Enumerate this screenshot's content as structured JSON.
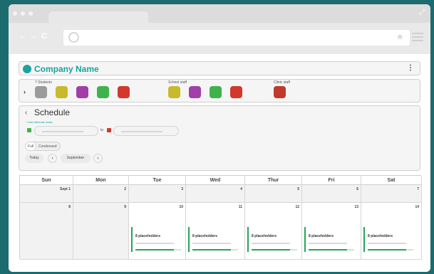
{
  "header": {
    "company_name": "Company Name",
    "menu_glyph": "⋮"
  },
  "staff": {
    "expand_glyph": "›",
    "groups": [
      {
        "label": "7 Students",
        "colors": [
          "#9b9b9b",
          "#c9b92c",
          "#a23ea7",
          "#3fb34b",
          "#d0392b"
        ]
      },
      {
        "label": "School staff",
        "colors": [
          "#c9b92c",
          "#a23ea7",
          "#3fb34b",
          "#d0392b"
        ]
      },
      {
        "label": "Clinic staff",
        "colors": [
          "#c0392b"
        ]
      }
    ]
  },
  "schedule": {
    "title": "Schedule",
    "back_glyph": "‹",
    "add_link": "+ Add alternate dates",
    "to_label": "to",
    "view_toggle": {
      "full": "Full",
      "condensed": "Condensed",
      "selected": "Full"
    },
    "today_label": "Today",
    "prev_glyph": "‹",
    "next_glyph": "›",
    "month_label": "September"
  },
  "calendar": {
    "days": [
      "Sun",
      "Mon",
      "Tue",
      "Wed",
      "Thur",
      "Fri",
      "Sat"
    ],
    "week1": [
      "Sept 1",
      "2",
      "3",
      "4",
      "5",
      "6",
      "7"
    ],
    "week2": [
      "8",
      "9",
      "10",
      "11",
      "12",
      "13",
      "14"
    ],
    "event_text": "8 placeholders",
    "event_progress": 0.85,
    "event_color": "#23a55a"
  },
  "browser": {
    "nav_glyphs": [
      "←",
      "→",
      "C"
    ],
    "star_glyph": "★",
    "expand_glyph": "⤢"
  }
}
